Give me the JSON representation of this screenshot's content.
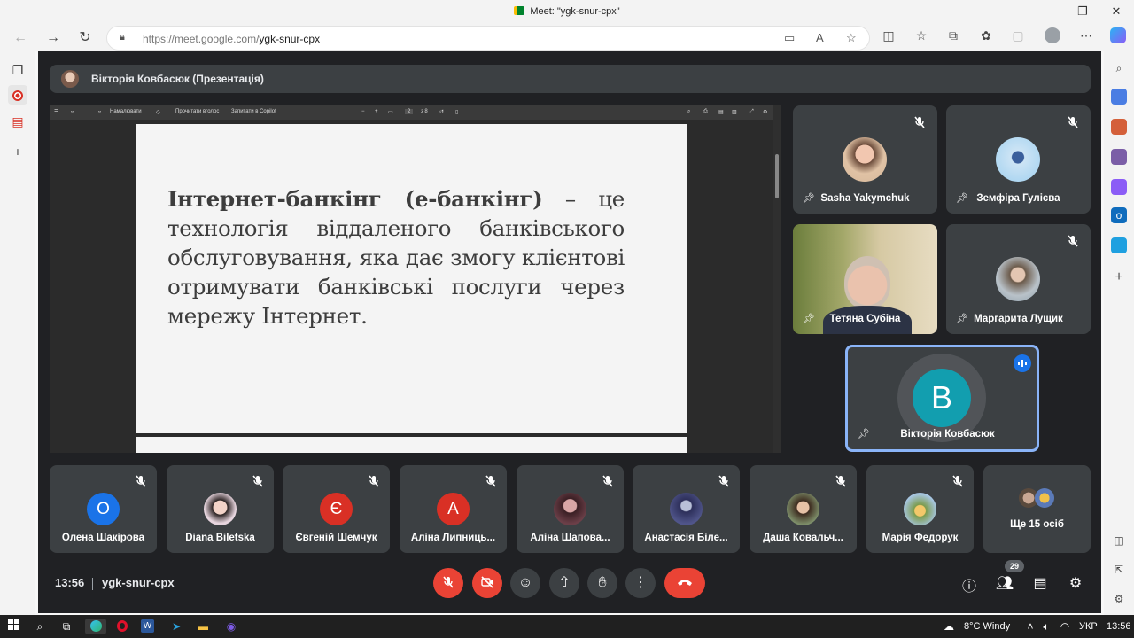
{
  "window": {
    "title": "Meet: \"ygk-snur-cpx\"",
    "controls": [
      "–",
      "❐",
      "✕"
    ]
  },
  "browser": {
    "url_prefix": "https://meet.google.com/",
    "url_path": "ygk-snur-cpx"
  },
  "presenter_bar": {
    "label": "Вікторія Ковбасюк (Презентація)"
  },
  "pdf_toolbar": {
    "draw_label": "Намалювати",
    "read_label": "Прочитати вголос",
    "ask_label": "Запитати в Copilot",
    "page_current": "2",
    "page_total": "з 8"
  },
  "slide": {
    "term": "Інтернет-банкінг (е-банкінг)",
    "body": "– це технологія віддаленого банківського обслуговування, яка дає змогу клієнтові отримувати банківські послуги через мережу Інтернет."
  },
  "tiles": {
    "t1": {
      "name": "Sasha Yakymchuk"
    },
    "t2": {
      "name": "Земфіра Гулієва"
    },
    "t3": {
      "name": "Тетяна Субіна"
    },
    "t4": {
      "name": "Маргарита Лущик"
    },
    "speaker": {
      "name": "Вікторія Ковбасюк",
      "initial": "В"
    }
  },
  "bottom_tiles": [
    {
      "name": "Олена Шакірова",
      "initial": "О",
      "color": "#1a73e8"
    },
    {
      "name": "Diana Biletska"
    },
    {
      "name": "Євгеній Шемчук",
      "initial": "Є",
      "color": "#d93025"
    },
    {
      "name": "Аліна Липниць...",
      "initial": "А",
      "color": "#d93025"
    },
    {
      "name": "Аліна Шапова..."
    },
    {
      "name": "Анастасія Біле..."
    },
    {
      "name": "Даша Ковальч..."
    },
    {
      "name": "Марія Федорук"
    }
  ],
  "more": {
    "label": "Ще 15 осіб"
  },
  "footer": {
    "time": "13:56",
    "meeting_code": "ygk-snur-cpx",
    "participants_count": "29"
  },
  "taskbar": {
    "weather": "8°C  Windy",
    "lang": "УКР",
    "time": "13:56"
  },
  "colors": {
    "meet_bg": "#202124",
    "tile_bg": "#3c4043",
    "end_call": "#ea4335",
    "speaker_border": "#8ab4f8",
    "speaker_avatar": "#129eaf"
  }
}
